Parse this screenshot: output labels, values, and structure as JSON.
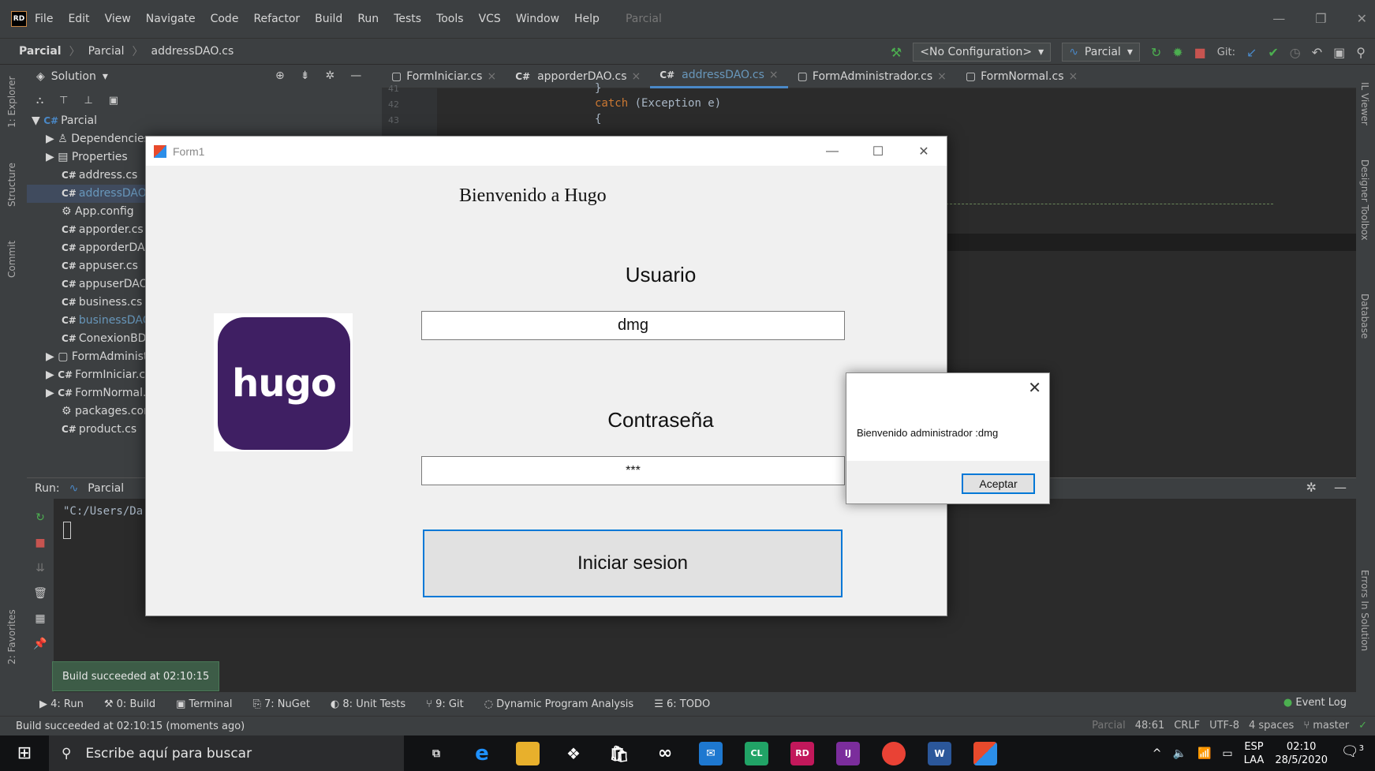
{
  "ide": {
    "menu": [
      "File",
      "Edit",
      "View",
      "Navigate",
      "Code",
      "Refactor",
      "Build",
      "Run",
      "Tests",
      "Tools",
      "VCS",
      "Window",
      "Help"
    ],
    "project_name": "Parcial",
    "breadcrumbs": [
      "Parcial",
      "Parcial",
      "addressDAO.cs"
    ],
    "run_config": "<No Configuration>",
    "parcial_combo": "Parcial",
    "git_label": "Git:",
    "left_strip": [
      "1: Explorer",
      "Structure",
      "Commit",
      "2: Favorites"
    ],
    "right_strip": [
      "IL Viewer",
      "Designer Toolbox",
      "Database",
      "Errors In Solution"
    ]
  },
  "explorer": {
    "title": "Solution",
    "root": "Parcial",
    "items": [
      "Dependencies",
      "Properties",
      "address.cs",
      "addressDAO.cs",
      "App.config",
      "apporder.cs",
      "apporderDAO.cs",
      "appuser.cs",
      "appuserDAO.cs",
      "business.cs",
      "businessDAO.cs",
      "ConexionBD.cs",
      "FormAdministrador.cs",
      "FormIniciar.cs",
      "FormNormal.cs",
      "packages.config",
      "product.cs"
    ]
  },
  "editor": {
    "tabs": [
      "FormIniciar.cs",
      "apporderDAO.cs",
      "addressDAO.cs",
      "FormAdministrador.cs",
      "FormNormal.cs"
    ],
    "active_tab": "addressDAO.cs",
    "line_numbers": [
      "41",
      "42",
      "43"
    ],
    "code_line_1": "}",
    "code_keyword": "catch",
    "code_line_2": " (Exception e)",
    "code_line_3": "{"
  },
  "run": {
    "label": "Run:",
    "config": "Parcial",
    "output": "\"C:/Users/Da"
  },
  "toast": "Build succeeded at 02:10:15",
  "toolwindows": [
    "4: Run",
    "0: Build",
    "Terminal",
    "7: NuGet",
    "8: Unit Tests",
    "9: Git",
    "Dynamic Program Analysis",
    "6: TODO"
  ],
  "event_log": "Event Log",
  "status": {
    "message": "Build succeeded at 02:10:15 (moments ago)",
    "project": "Parcial",
    "position": "48:61",
    "line_ending": "CRLF",
    "encoding": "UTF-8",
    "indent": "4 spaces",
    "branch": "master"
  },
  "form1": {
    "title": "Form1",
    "welcome": "Bienvenido a Hugo",
    "user_label": "Usuario",
    "user_value": "dmg",
    "pass_label": "Contraseña",
    "pass_value": "***",
    "login_button": "Iniciar sesion",
    "logo_text": "hugo",
    "logo_color": "#3f1f63"
  },
  "msgbox": {
    "message": "Bienvenido administrador :dmg",
    "ok_button": "Aceptar"
  },
  "taskbar": {
    "search_placeholder": "Escribe aquí para buscar",
    "lang_top": "ESP",
    "lang_bottom": "LAA",
    "time": "02:10",
    "date": "28/5/2020",
    "notifications": "3"
  }
}
